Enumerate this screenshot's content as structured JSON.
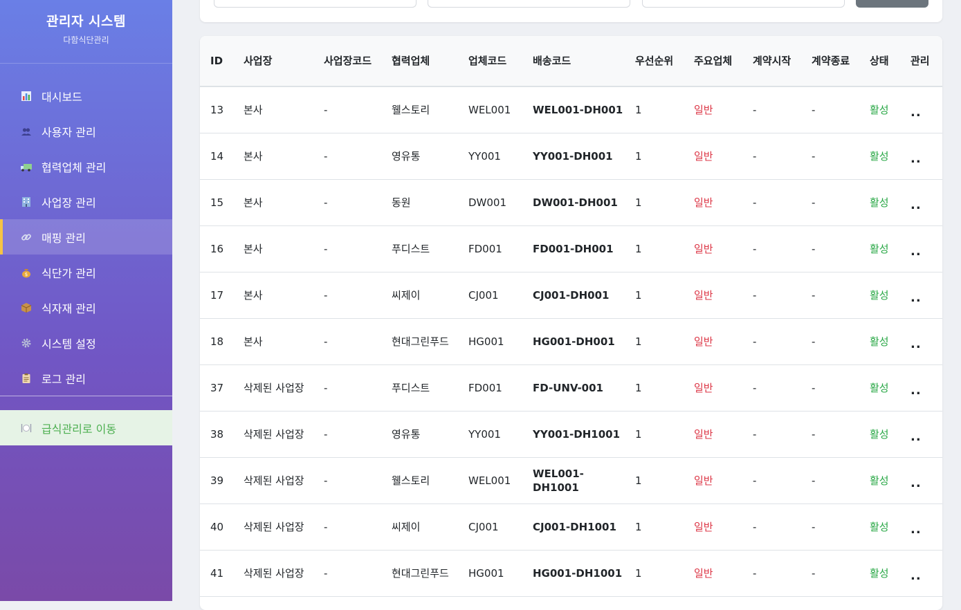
{
  "sidebar": {
    "title": "관리자 시스템",
    "subtitle": "다함식단관리",
    "items": [
      {
        "label": "대시보드",
        "icon": "chart-icon"
      },
      {
        "label": "사용자 관리",
        "icon": "users-icon"
      },
      {
        "label": "협력업체 관리",
        "icon": "truck-icon"
      },
      {
        "label": "사업장 관리",
        "icon": "building-icon"
      },
      {
        "label": "매핑 관리",
        "icon": "link-icon"
      },
      {
        "label": "식단가 관리",
        "icon": "money-bag-icon"
      },
      {
        "label": "식자재 관리",
        "icon": "box-icon"
      },
      {
        "label": "시스템 설정",
        "icon": "gear-icon"
      },
      {
        "label": "로그 관리",
        "icon": "clipboard-icon"
      }
    ],
    "active_index": 4,
    "goto_label": "급식관리로 이동"
  },
  "table": {
    "headers": [
      "ID",
      "사업장",
      "사업장코드",
      "협력업체",
      "업체코드",
      "배송코드",
      "우선순위",
      "주요업체",
      "계약시작",
      "계약종료",
      "상태",
      "관리"
    ],
    "rows": [
      {
        "id": "13",
        "site": "본사",
        "site_code": "-",
        "vendor": "웰스토리",
        "vendor_code": "WEL001",
        "delivery_code": "WEL001-DH001",
        "priority": "1",
        "type": "일반",
        "start": "-",
        "end": "-",
        "status": "활성",
        "actions": ".."
      },
      {
        "id": "14",
        "site": "본사",
        "site_code": "-",
        "vendor": "영유통",
        "vendor_code": "YY001",
        "delivery_code": "YY001-DH001",
        "priority": "1",
        "type": "일반",
        "start": "-",
        "end": "-",
        "status": "활성",
        "actions": ".."
      },
      {
        "id": "15",
        "site": "본사",
        "site_code": "-",
        "vendor": "동원",
        "vendor_code": "DW001",
        "delivery_code": "DW001-DH001",
        "priority": "1",
        "type": "일반",
        "start": "-",
        "end": "-",
        "status": "활성",
        "actions": ".."
      },
      {
        "id": "16",
        "site": "본사",
        "site_code": "-",
        "vendor": "푸디스트",
        "vendor_code": "FD001",
        "delivery_code": "FD001-DH001",
        "priority": "1",
        "type": "일반",
        "start": "-",
        "end": "-",
        "status": "활성",
        "actions": ".."
      },
      {
        "id": "17",
        "site": "본사",
        "site_code": "-",
        "vendor": "씨제이",
        "vendor_code": "CJ001",
        "delivery_code": "CJ001-DH001",
        "priority": "1",
        "type": "일반",
        "start": "-",
        "end": "-",
        "status": "활성",
        "actions": ".."
      },
      {
        "id": "18",
        "site": "본사",
        "site_code": "-",
        "vendor": "현대그린푸드",
        "vendor_code": "HG001",
        "delivery_code": "HG001-DH001",
        "priority": "1",
        "type": "일반",
        "start": "-",
        "end": "-",
        "status": "활성",
        "actions": ".."
      },
      {
        "id": "37",
        "site": "삭제된 사업장",
        "site_code": "-",
        "vendor": "푸디스트",
        "vendor_code": "FD001",
        "delivery_code": "FD-UNV-001",
        "priority": "1",
        "type": "일반",
        "start": "-",
        "end": "-",
        "status": "활성",
        "actions": ".."
      },
      {
        "id": "38",
        "site": "삭제된 사업장",
        "site_code": "-",
        "vendor": "영유통",
        "vendor_code": "YY001",
        "delivery_code": "YY001-DH1001",
        "priority": "1",
        "type": "일반",
        "start": "-",
        "end": "-",
        "status": "활성",
        "actions": ".."
      },
      {
        "id": "39",
        "site": "삭제된 사업장",
        "site_code": "-",
        "vendor": "웰스토리",
        "vendor_code": "WEL001",
        "delivery_code": "WEL001-DH1001",
        "priority": "1",
        "type": "일반",
        "start": "-",
        "end": "-",
        "status": "활성",
        "actions": ".."
      },
      {
        "id": "40",
        "site": "삭제된 사업장",
        "site_code": "-",
        "vendor": "씨제이",
        "vendor_code": "CJ001",
        "delivery_code": "CJ001-DH1001",
        "priority": "1",
        "type": "일반",
        "start": "-",
        "end": "-",
        "status": "활성",
        "actions": ".."
      },
      {
        "id": "41",
        "site": "삭제된 사업장",
        "site_code": "-",
        "vendor": "현대그린푸드",
        "vendor_code": "HG001",
        "delivery_code": "HG001-DH1001",
        "priority": "1",
        "type": "일반",
        "start": "-",
        "end": "-",
        "status": "활성",
        "actions": ".."
      }
    ]
  },
  "colors": {
    "accent": "#f6c445",
    "status_active": "#28a745",
    "type_normal": "#dc3545"
  }
}
